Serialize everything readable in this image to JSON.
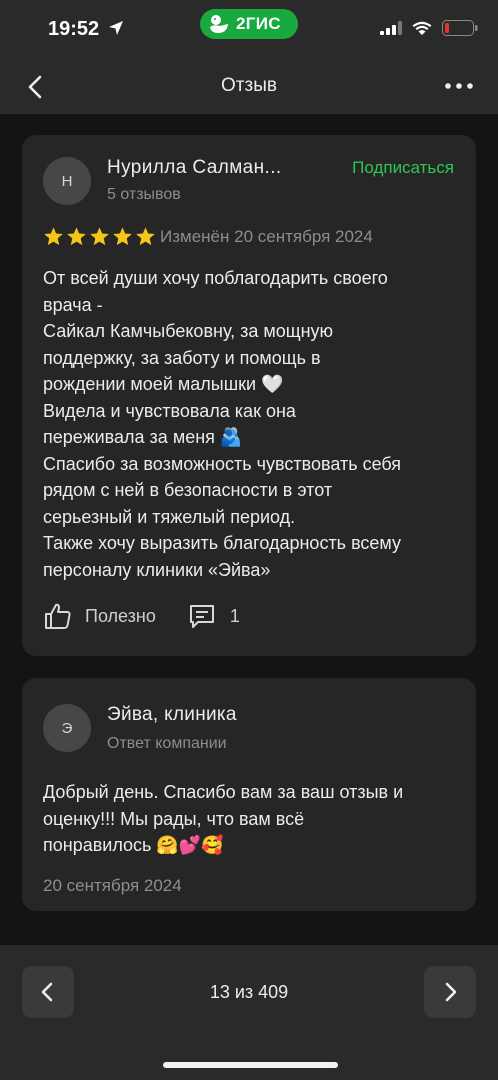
{
  "status_bar": {
    "time": "19:52",
    "app_badge": "2ГИС",
    "badge_color": "#19aa3f",
    "battery_color": "#e8352b"
  },
  "nav": {
    "title": "Отзыв",
    "back_icon": "chevron-left-icon",
    "more_icon": "more-horizontal-icon"
  },
  "review": {
    "avatar_letter": "Н",
    "author": "Нурилла Салман...",
    "reviews_count": "5 отзывов",
    "subscribe_label": "Подписаться",
    "subscribe_color": "#2ec654",
    "rating": 5,
    "star_color": "#f5c518",
    "edited": "Изменён 20 сентября 2024",
    "text_lines": [
      "От всей души хочу поблагодарить своего",
      "врача -",
      "Сайкал Камчыбековну, за мощную",
      "поддержку, за заботу и помощь в",
      "рождении моей малышки 🤍",
      "Видела и чувствовала как она",
      "переживала за меня 🫂",
      "Спасибо за возможность чувствовать себя",
      "рядом с ней в безопасности в этот",
      "серьезный и тяжелый период.",
      "Также хочу выразить благодарность всему",
      "персоналу клиники «Эйва»"
    ],
    "useful_label": "Полезно",
    "comments_count": "1"
  },
  "reply": {
    "avatar_letter": "Э",
    "author": "Эйва, клиника",
    "subtitle": "Ответ компании",
    "text_lines": [
      "Добрый день. Спасибо вам за ваш отзыв и",
      "оценку!!! Мы рады, что вам всё",
      "понравилось 🤗💕🥰"
    ],
    "date": "20 сентября 2024"
  },
  "pager": {
    "label": "13 из 409"
  }
}
